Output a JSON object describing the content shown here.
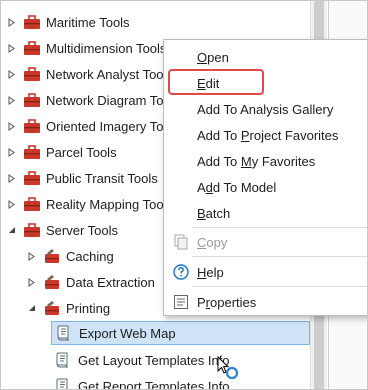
{
  "tree": {
    "items": [
      {
        "label": "Maritime Tools",
        "level": 0,
        "state": "collapsed"
      },
      {
        "label": "Multidimension Tools",
        "level": 0,
        "state": "collapsed"
      },
      {
        "label": "Network Analyst Tools",
        "level": 0,
        "state": "collapsed"
      },
      {
        "label": "Network Diagram Tools",
        "level": 0,
        "state": "collapsed"
      },
      {
        "label": "Oriented Imagery Tools",
        "level": 0,
        "state": "collapsed"
      },
      {
        "label": "Parcel Tools",
        "level": 0,
        "state": "collapsed"
      },
      {
        "label": "Public Transit Tools",
        "level": 0,
        "state": "collapsed"
      },
      {
        "label": "Reality Mapping Tools",
        "level": 0,
        "state": "collapsed"
      },
      {
        "label": "Server Tools",
        "level": 0,
        "state": "expanded"
      },
      {
        "label": "Caching",
        "level": 1,
        "state": "collapsed"
      },
      {
        "label": "Data Extraction",
        "level": 1,
        "state": "collapsed"
      },
      {
        "label": "Printing",
        "level": 1,
        "state": "expanded"
      },
      {
        "label": "Export Web Map",
        "level": 2,
        "state": "leaf",
        "selected": true
      },
      {
        "label": "Get Layout Templates Info",
        "level": 2,
        "state": "leaf"
      },
      {
        "label": "Get Report Templates Info",
        "level": 2,
        "state": "leaf"
      }
    ]
  },
  "context_menu": {
    "items": [
      {
        "pre": "",
        "ul": "O",
        "post": "pen",
        "icon": "",
        "disabled": false
      },
      {
        "pre": "",
        "ul": "E",
        "post": "dit",
        "icon": "",
        "disabled": false
      },
      {
        "pre": "Add To Analysis Gallery",
        "ul": "",
        "post": "",
        "icon": "",
        "disabled": false
      },
      {
        "pre": "Add To ",
        "ul": "P",
        "post": "roject Favorites",
        "icon": "",
        "disabled": false
      },
      {
        "pre": "Add To ",
        "ul": "M",
        "post": "y Favorites",
        "icon": "",
        "disabled": false
      },
      {
        "pre": "A",
        "ul": "d",
        "post": "d To Model",
        "icon": "",
        "disabled": false
      },
      {
        "pre": "",
        "ul": "B",
        "post": "atch",
        "icon": "",
        "disabled": false
      },
      {
        "pre": "",
        "ul": "C",
        "post": "opy",
        "icon": "copy-icon",
        "disabled": true
      },
      {
        "pre": "",
        "ul": "H",
        "post": "elp",
        "icon": "help-icon",
        "disabled": false
      },
      {
        "pre": "P",
        "ul": "r",
        "post": "operties",
        "icon": "properties-icon",
        "disabled": false
      }
    ],
    "highlighted_item": "Edit"
  },
  "colors": {
    "toolbox_red": "#c8392b",
    "selection_bg": "#cfe3f7",
    "highlight_outline": "#e04a4a",
    "help_blue": "#1a73c9"
  }
}
